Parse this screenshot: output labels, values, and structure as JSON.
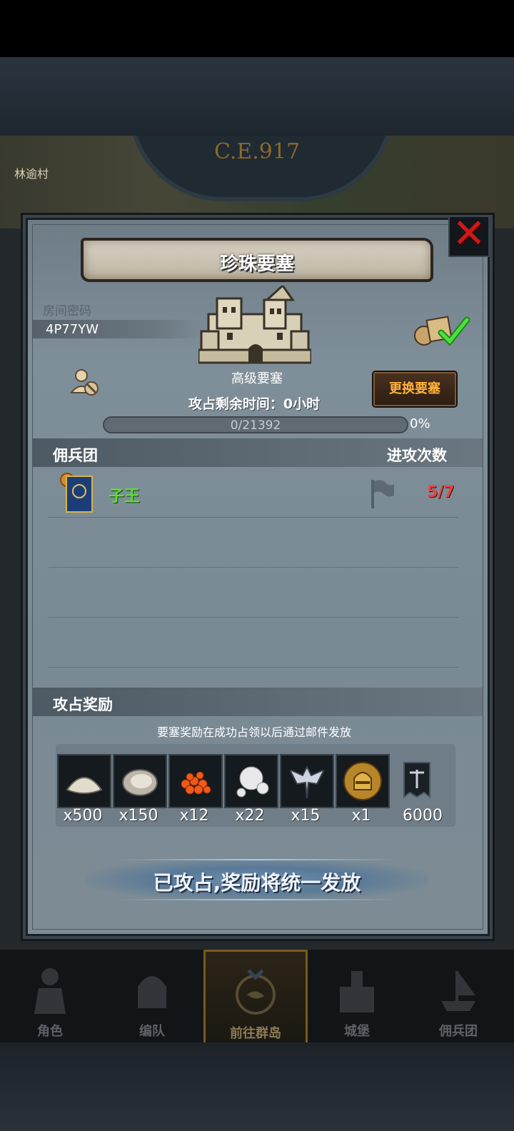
{
  "background": {
    "era": "C.E.917",
    "village_label": "林逾村"
  },
  "dialog": {
    "title": "珍珠要塞",
    "room_code_label": "房间密码",
    "room_code": "4P77YW",
    "fortress_type": "高级要塞",
    "change_button": "更换要塞",
    "occupy_time": "攻占剩余时间：0小时",
    "progress": {
      "text": "0/21392",
      "percent": "0%",
      "fraction": 0
    },
    "mercenary_header": "佣兵团",
    "attacks_header": "进攻次数",
    "guild": {
      "name": "子王",
      "attacks": "5/7"
    },
    "rewards_header": "攻占奖励",
    "rewards_note": "要塞奖励在成功占领以后通过邮件发放",
    "rewards": [
      {
        "icon": "flour-pile-icon",
        "count": "x500"
      },
      {
        "icon": "oyster-icon",
        "count": "x150"
      },
      {
        "icon": "fish-roe-icon",
        "count": "x12"
      },
      {
        "icon": "pearl-icon",
        "count": "x22"
      },
      {
        "icon": "winged-emblem-icon",
        "count": "x15"
      },
      {
        "icon": "knight-helmet-coin-icon",
        "count": "x1"
      },
      {
        "icon": "guild-banner-currency-icon",
        "count": "6000"
      }
    ],
    "claim_status": "已攻占,奖励将统一发放"
  },
  "bottom_nav": [
    {
      "label": "角色",
      "icon": "character-icon"
    },
    {
      "label": "编队",
      "icon": "formation-icon"
    },
    {
      "label": "前往群岛",
      "icon": "islands-icon",
      "active": true
    },
    {
      "label": "城堡",
      "icon": "castle-icon"
    },
    {
      "label": "佣兵团",
      "icon": "mercenary-ship-icon"
    }
  ],
  "colors": {
    "guild_name": "#5fe03a",
    "attack_count": "#e84444",
    "change_button_text": "#ffb23a",
    "close_x": "#d01818"
  }
}
